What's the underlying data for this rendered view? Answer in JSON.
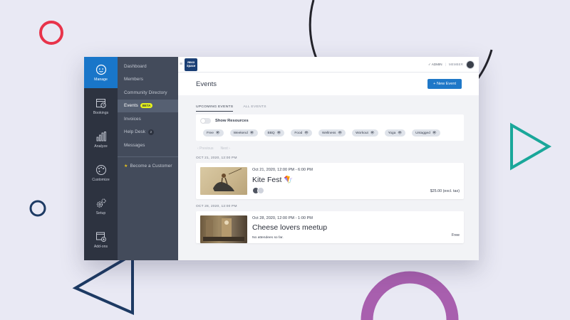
{
  "colors": {
    "background": "#e9e9f4",
    "accent": "#1f78c8",
    "rail": "#2d3340",
    "subnav": "#434b5b",
    "beta_badge": "#e6f21c",
    "deco_red": "#e8334a",
    "deco_navy": "#1d3a63",
    "deco_teal": "#1aa79a",
    "deco_purple": "#a85fae",
    "deco_dark": "#23232a"
  },
  "rail": {
    "items": [
      {
        "label": "Manage",
        "icon": "manage-face-icon",
        "active": true
      },
      {
        "label": "Bookings",
        "icon": "calendar-clock-icon"
      },
      {
        "label": "Analyze",
        "icon": "bar-chart-icon"
      },
      {
        "label": "Customize",
        "icon": "palette-icon"
      },
      {
        "label": "Setup",
        "icon": "gears-icon"
      },
      {
        "label": "Add-ons",
        "icon": "add-window-icon"
      }
    ]
  },
  "subnav": {
    "items": [
      {
        "label": "Dashboard"
      },
      {
        "label": "Members"
      },
      {
        "label": "Community Directory"
      },
      {
        "label": "Events",
        "badge": "BETA",
        "active": true
      },
      {
        "label": "Invoices"
      },
      {
        "label": "Help Desk",
        "count": "2"
      },
      {
        "label": "Messages"
      }
    ],
    "become_customer": "Become a Customer"
  },
  "topbar": {
    "logo_text": "Hexa Space",
    "admin": "✓ ADMIN",
    "member": "MEMBER"
  },
  "page": {
    "title": "Events",
    "new_button": "+ New Event"
  },
  "tabs": [
    {
      "label": "UPCOMING EVENTS",
      "active": true
    },
    {
      "label": "ALL EVENTS"
    }
  ],
  "filters": {
    "toggle_label": "Show Resources",
    "chips": [
      "Free",
      "Weekend",
      "BBQ",
      "Food",
      "Wellness",
      "Workout",
      "Yoga",
      "Untagged"
    ]
  },
  "pager": {
    "previous": "‹ Previous",
    "next": "Next ›"
  },
  "events": [
    {
      "group_date": "OCT 21, 2020, 12:00 PM",
      "datetime": "Oct 21, 2020, 12:00 PM - 6:00 PM",
      "title": "Kite Fest 🪁",
      "price": "$25.00 (excl. tax)",
      "attendees": 2
    },
    {
      "group_date": "OCT 28, 2020, 12:00 PM",
      "datetime": "Oct 28, 2020, 12:00 PM - 1:00 PM",
      "title": "Cheese lovers meetup",
      "note": "No attendees so far.",
      "price": "Free"
    }
  ]
}
